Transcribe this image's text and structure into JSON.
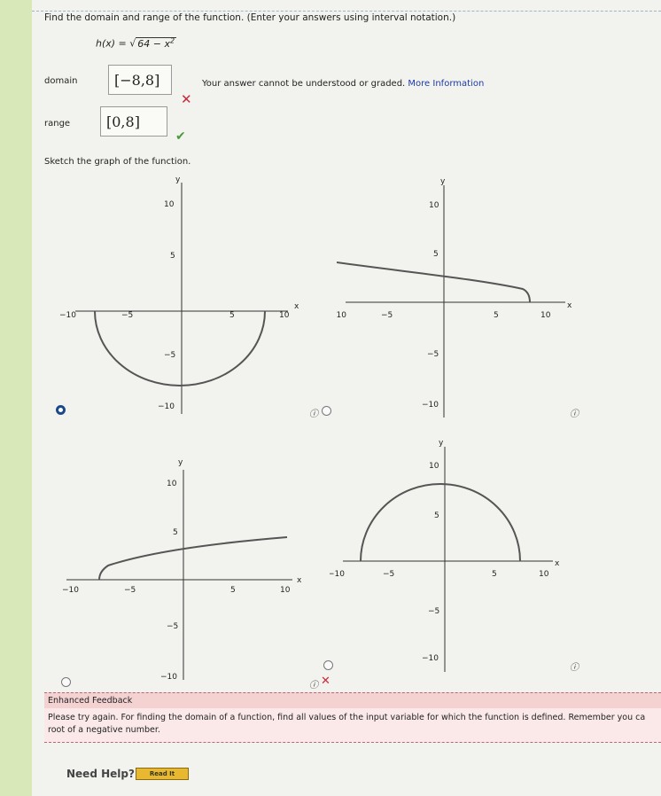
{
  "question": "Find the domain and range of the function. (Enter your answers using interval notation.)",
  "function": {
    "lhs": "h(x) = ",
    "radicand": "64 − x",
    "exponent": "2"
  },
  "domain": {
    "label": "domain",
    "value": "[−8,8]",
    "status": "incorrect"
  },
  "range": {
    "label": "range",
    "value": "[0,8]",
    "status": "correct"
  },
  "error_message": {
    "text": "Your answer cannot be understood or graded.",
    "link": "More Information"
  },
  "sketch_prompt": "Sketch the graph of the function.",
  "graph_labels": {
    "x_axis": "x",
    "y_axis": "y",
    "x_ticks": [
      "−10",
      "−5",
      "5",
      "10"
    ],
    "y_ticks": [
      "10",
      "5",
      "−5",
      "−10"
    ]
  },
  "graph_options": [
    {
      "id": "A",
      "shape": "lower semicircle",
      "selected": true
    },
    {
      "id": "B",
      "shape": "decreasing square-root",
      "selected": false
    },
    {
      "id": "C",
      "shape": "increasing square-root",
      "selected": false
    },
    {
      "id": "D",
      "shape": "upper semicircle",
      "selected": false
    }
  ],
  "feedback": {
    "title": "Enhanced Feedback",
    "body_line1": "Please try again. For finding the domain of a function, find all values of the input variable for which the function is defined. Remember you ca",
    "body_line2": "root of a negative number."
  },
  "help": {
    "label": "Need Help?",
    "button": "Read It"
  },
  "icons": {
    "info": "info-icon",
    "incorrect": "x-mark-icon",
    "correct": "check-icon"
  },
  "colors": {
    "incorrect": "#c8293a",
    "correct": "#4a9a3a",
    "link": "#1c3ca8",
    "selected_radio": "#1a4a8a"
  }
}
